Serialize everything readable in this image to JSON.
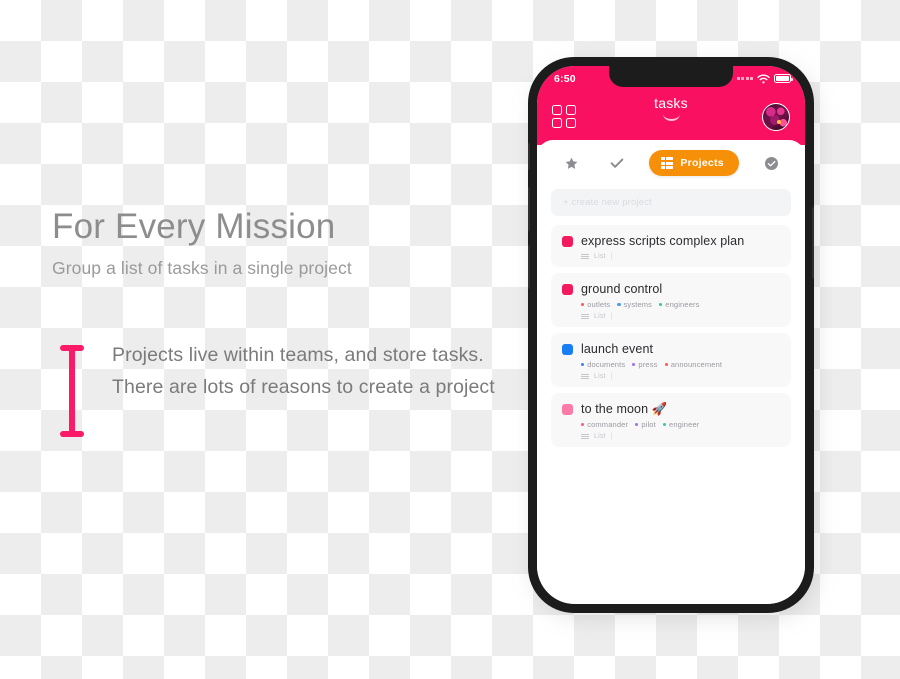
{
  "marketing": {
    "headline": "For Every Mission",
    "subhead": "Group a list of tasks in a single project",
    "body": "Projects live within teams, and store tasks. There are lots of reasons to create a project",
    "accent_color": "#fa1a67",
    "bracket_icon": "i-bracket-icon"
  },
  "phone": {
    "statusbar": {
      "time": "6:50",
      "signal_icon": "signal-dots-icon",
      "wifi_icon": "wifi-icon",
      "battery_icon": "battery-icon"
    },
    "header": {
      "menu_icon": "grid-menu-icon",
      "title": "tasks",
      "chevron_icon": "chevron-down-icon",
      "avatar_icon": "user-avatar",
      "background_color": "#fa1060"
    },
    "tabs": [
      {
        "icon": "star-icon",
        "label": "",
        "active": false
      },
      {
        "icon": "check-icon",
        "label": "",
        "active": false
      },
      {
        "icon": "list-icon",
        "label": "Projects",
        "active": true
      },
      {
        "icon": "check-circle-icon",
        "label": "",
        "active": false
      }
    ],
    "active_tab_color": "#f79009",
    "new_project": {
      "placeholder": "+ create new project"
    },
    "projects": [
      {
        "title": "express scripts complex plan",
        "swatch_color": "#f31a5e",
        "tags": [],
        "meta_label": "List",
        "meta_separator": "|"
      },
      {
        "title": "ground control",
        "swatch_color": "#f31a5e",
        "tags": [
          {
            "label": "outlets",
            "color": "#ff5a4d"
          },
          {
            "label": "systems",
            "color": "#4a9cf5"
          },
          {
            "label": "engineers",
            "color": "#35c98b"
          }
        ],
        "meta_label": "List",
        "meta_separator": "|"
      },
      {
        "title": "launch event",
        "swatch_color": "#1a7ef3",
        "tags": [
          {
            "label": "documents",
            "color": "#3b82f6"
          },
          {
            "label": "press",
            "color": "#9b6df5"
          },
          {
            "label": "announcement",
            "color": "#ff5a4d"
          }
        ],
        "meta_label": "List",
        "meta_separator": "|"
      },
      {
        "title": "to the moon 🚀",
        "swatch_color": "#fb7aa8",
        "tags": [
          {
            "label": "commander",
            "color": "#ff5a7d"
          },
          {
            "label": "pilot",
            "color": "#9b6df5"
          },
          {
            "label": "engineer",
            "color": "#35c9b0"
          }
        ],
        "meta_label": "List",
        "meta_separator": "|"
      }
    ]
  }
}
